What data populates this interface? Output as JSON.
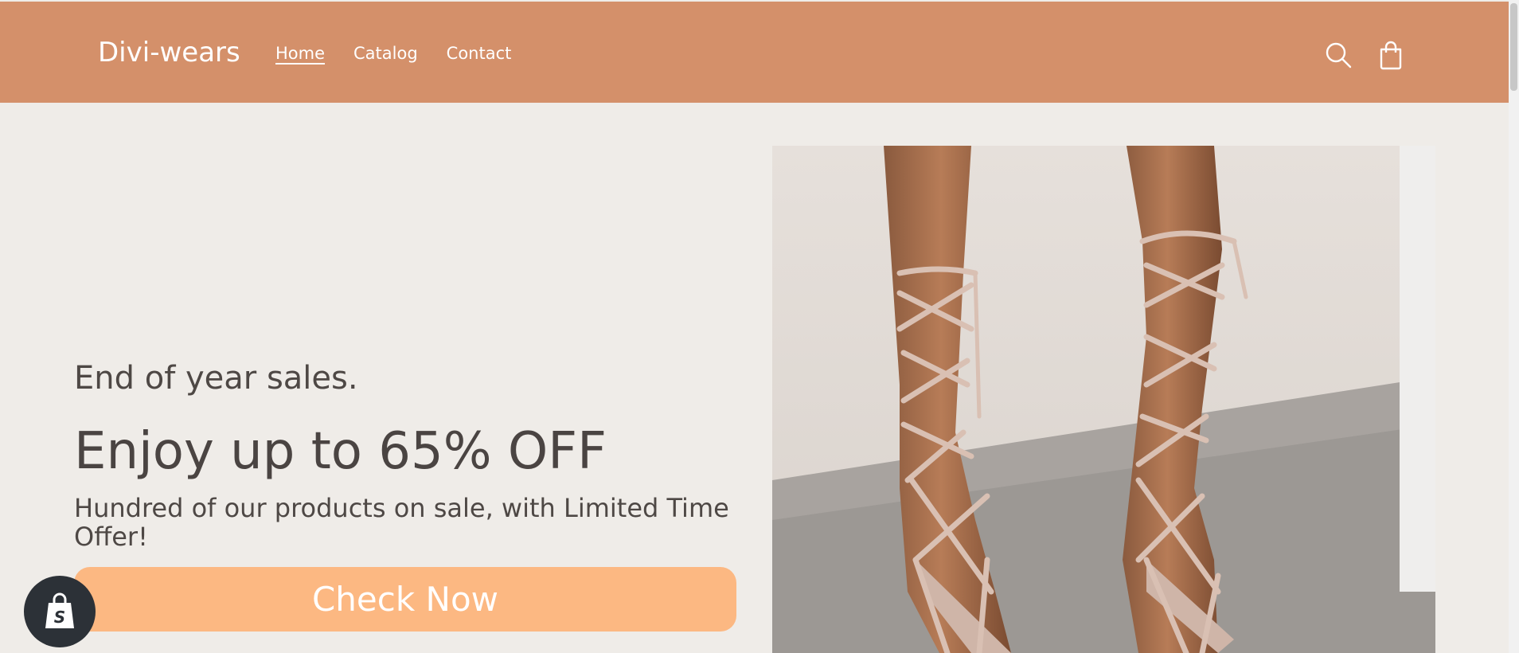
{
  "header": {
    "brand": "Divi-wears",
    "nav": [
      {
        "label": "Home",
        "active": true
      },
      {
        "label": "Catalog",
        "active": false
      },
      {
        "label": "Contact",
        "active": false
      }
    ],
    "icons": [
      "search-icon",
      "cart-icon"
    ],
    "background_color": "#d4906a"
  },
  "hero": {
    "kicker": "End of year sales.",
    "headline": "Enjoy up to 65% OFF",
    "subtext": "Hundred of our products on sale, with Limited Time Offer!",
    "cta_label": "Check Now",
    "cta_color": "#fcb882",
    "image": "lace-up-heels-photo"
  },
  "page": {
    "background_color": "#efece8"
  },
  "badge": {
    "icon": "shopify-bag-icon"
  }
}
